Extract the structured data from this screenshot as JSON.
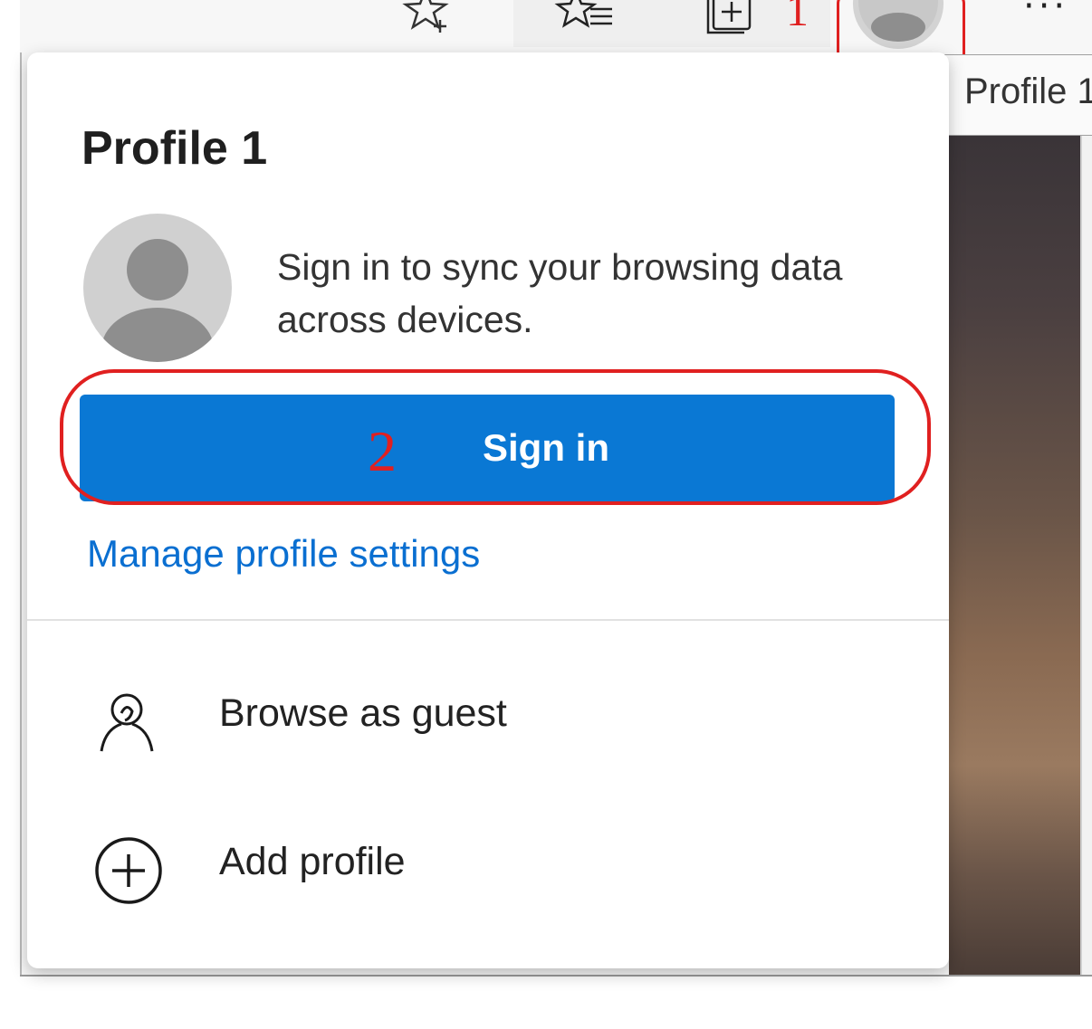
{
  "tooltip": {
    "text": "Profile 1"
  },
  "annotations": {
    "step1": "1",
    "step2": "2"
  },
  "panel": {
    "title": "Profile 1",
    "sync_message": "Sign in to sync your browsing data across devices.",
    "sign_in_label": "Sign in",
    "manage_link": "Manage profile settings",
    "menu": [
      {
        "label": "Browse as guest",
        "icon": "guest-icon"
      },
      {
        "label": "Add profile",
        "icon": "add-profile-icon"
      }
    ]
  },
  "toolbar": {
    "icons": [
      "add-favorite-icon",
      "favorites-icon",
      "collections-icon",
      "profile-icon",
      "more-options-icon"
    ]
  },
  "colors": {
    "accent": "#0a78d4",
    "link": "#0a6fd1",
    "annotation": "#e02020"
  }
}
